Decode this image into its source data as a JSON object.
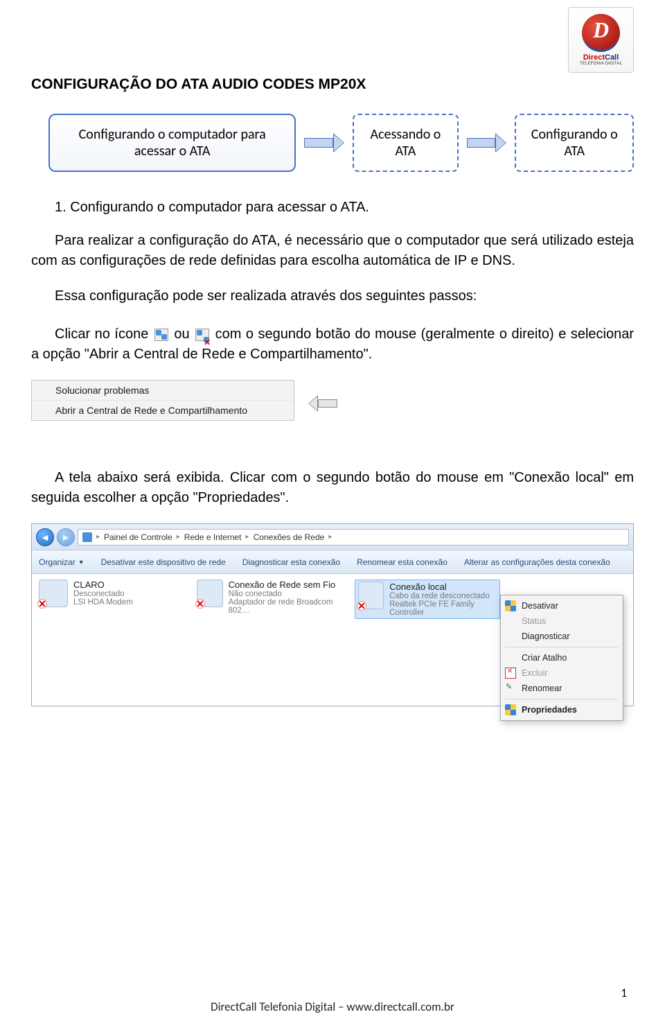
{
  "logo": {
    "brand1": "Direct",
    "brand2": "Call",
    "tag": "TELEFONIA DIGITAL"
  },
  "title": "CONFIGURAÇÃO DO ATA AUDIO CODES MP20X",
  "flow": {
    "box1": "Configurando o computador para acessar o ATA",
    "box2": "Acessando o ATA",
    "box3": "Configurando o ATA"
  },
  "section1_heading": "1. Configurando o computador para acessar o ATA.",
  "para1": "Para realizar a configuração do ATA, é necessário que o computador que será utilizado esteja com as configurações de rede definidas para escolha automática de IP e DNS.",
  "para2": "Essa configuração pode ser realizada através dos seguintes passos:",
  "para3a": "Clicar no ícone ",
  "para3b": " ou ",
  "para3c": " com o segundo botão do mouse (geralmente o direito) e selecionar a opção \"Abrir a Central de Rede e Compartilhamento\".",
  "ctxmenu1": {
    "item1": "Solucionar problemas",
    "item2": "Abrir a Central de Rede e Compartilhamento"
  },
  "para4": "A tela abaixo será exibida. Clicar com o segundo botão do mouse em \"Conexão local\" em seguida escolher a opção \"Propriedades\".",
  "explorer": {
    "breadcrumbs": [
      "Painel de Controle",
      "Rede e Internet",
      "Conexões de Rede"
    ],
    "toolbar": {
      "organize": "Organizar",
      "disable": "Desativar este dispositivo de rede",
      "diagnose": "Diagnosticar esta conexão",
      "rename": "Renomear esta conexão",
      "change": "Alterar as configurações desta conexão"
    },
    "connections": [
      {
        "name": "CLARO",
        "line2": "Desconectado",
        "line3": "LSI HDA Modem"
      },
      {
        "name": "Conexão de Rede sem Fio",
        "line2": "Não conectado",
        "line3": "Adaptador de rede Broadcom 802…"
      },
      {
        "name": "Conexão local",
        "line2": "Cabo da rede desconectado",
        "line3": "Realtek PCIe FE Family Controller"
      }
    ],
    "ctxmenu": {
      "disable": "Desativar",
      "status": "Status",
      "diagnose": "Diagnosticar",
      "shortcut": "Criar Atalho",
      "delete": "Excluir",
      "rename": "Renomear",
      "properties": "Propriedades"
    }
  },
  "footer": "DirectCall Telefonia Digital – www.directcall.com.br",
  "pagenum": "1"
}
